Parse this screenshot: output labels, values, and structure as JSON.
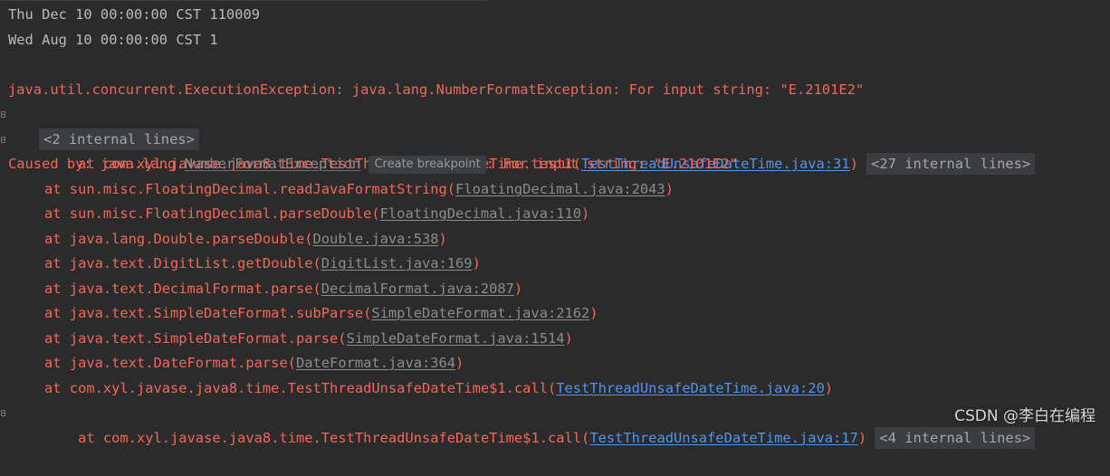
{
  "colors": {
    "background": "#2b2b2b",
    "stdout_text": "#bbbbbb",
    "error_text": "#f3675b",
    "project_link": "#5394ec",
    "library_link": "#8c8c8c",
    "fold_background": "#3b3d40"
  },
  "output_lines": [
    "Thu Dec 10 00:00:00 CST 110009",
    "Wed Aug 10 00:00:00 CST 1"
  ],
  "exception_header": "java.util.concurrent.ExecutionException: java.lang.NumberFormatException: For input string: \"E.2101E2\"",
  "fold1": {
    "label": "<2 internal lines>"
  },
  "frame_test1": {
    "prefix": "at com.xyl.javase.java8.time.TestThreadUnsafeDateTime.test1(",
    "link": "TestThreadUnsafeDateTime.java:31",
    "suffix": ")",
    "fold_label": "<27 internal lines>"
  },
  "caused_by": {
    "prefix": "Caused by: java.lang.",
    "class_name": "NumberFormatException",
    "tooltip": "Create breakpoint",
    "suffix": ": For input string: \"E.2101E2\""
  },
  "frames": [
    {
      "prefix": "at sun.misc.FloatingDecimal.readJavaFormatString(",
      "link": "FloatingDecimal.java:2043",
      "suffix": ")"
    },
    {
      "prefix": "at sun.misc.FloatingDecimal.parseDouble(",
      "link": "FloatingDecimal.java:110",
      "suffix": ")"
    },
    {
      "prefix": "at java.lang.Double.parseDouble(",
      "link": "Double.java:538",
      "suffix": ")"
    },
    {
      "prefix": "at java.text.DigitList.getDouble(",
      "link": "DigitList.java:169",
      "suffix": ")"
    },
    {
      "prefix": "at java.text.DecimalFormat.parse(",
      "link": "DecimalFormat.java:2087",
      "suffix": ")"
    },
    {
      "prefix": "at java.text.SimpleDateFormat.subParse(",
      "link": "SimpleDateFormat.java:2162",
      "suffix": ")"
    },
    {
      "prefix": "at java.text.SimpleDateFormat.parse(",
      "link": "SimpleDateFormat.java:1514",
      "suffix": ")"
    },
    {
      "prefix": "at java.text.DateFormat.parse(",
      "link": "DateFormat.java:364",
      "suffix": ")"
    }
  ],
  "frame_call20": {
    "prefix": "at com.xyl.javase.java8.time.TestThreadUnsafeDateTime$1.call(",
    "link": "TestThreadUnsafeDateTime.java:20",
    "suffix": ")"
  },
  "frame_call17": {
    "prefix": "at com.xyl.javase.java8.time.TestThreadUnsafeDateTime$1.call(",
    "link": "TestThreadUnsafeDateTime.java:17",
    "suffix": ")",
    "fold_label": "<4 internal lines>"
  },
  "watermark": "CSDN @李白在编程"
}
